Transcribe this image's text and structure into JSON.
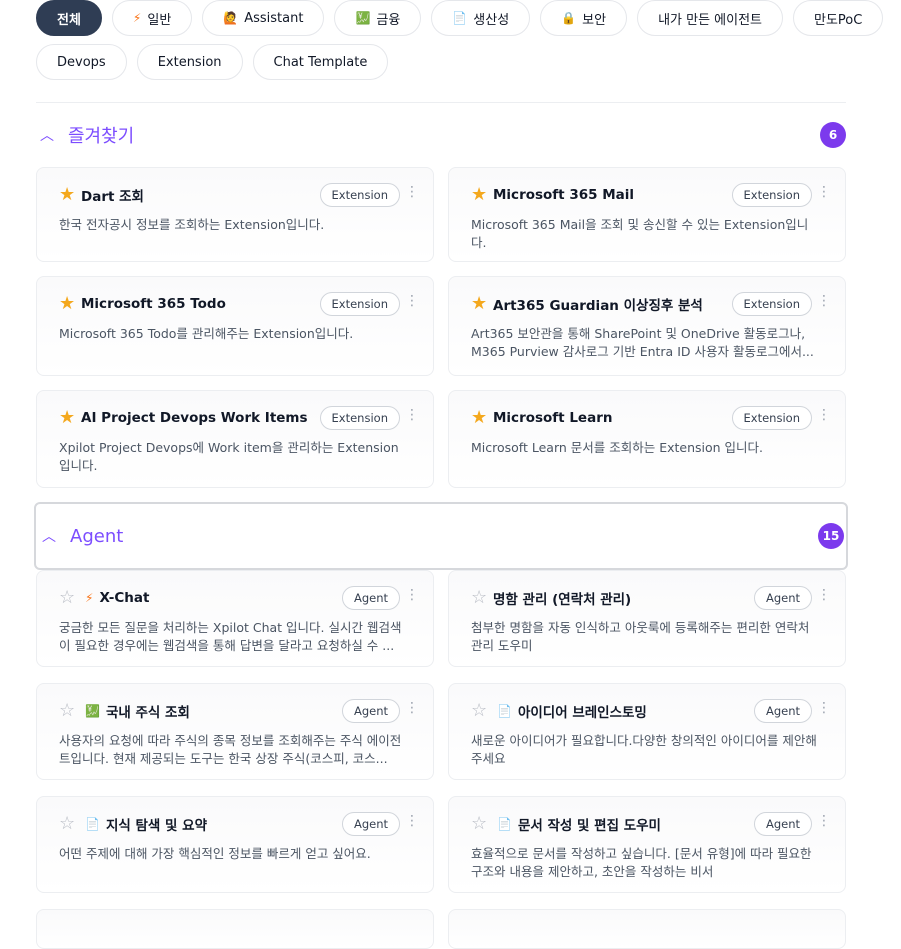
{
  "filters": {
    "row1": [
      {
        "label": "전체",
        "icon": "",
        "active": true
      },
      {
        "label": "일반",
        "icon": "⚡",
        "active": false
      },
      {
        "label": "Assistant",
        "icon": "🙋",
        "active": false
      },
      {
        "label": "금융",
        "icon": "💹",
        "active": false
      },
      {
        "label": "생산성",
        "icon": "📄",
        "active": false
      },
      {
        "label": "보안",
        "icon": "🔒",
        "active": false
      },
      {
        "label": "내가 만든 에이전트",
        "icon": "",
        "active": false
      },
      {
        "label": "만도PoC",
        "icon": "",
        "active": false
      }
    ],
    "row2": [
      {
        "label": "Devops",
        "icon": "",
        "active": false
      },
      {
        "label": "Extension",
        "icon": "",
        "active": false
      },
      {
        "label": "Chat Template",
        "icon": "",
        "active": false
      }
    ]
  },
  "favorites": {
    "title": "즐겨찾기",
    "count": "6",
    "cards": [
      {
        "name": "Dart 조회",
        "badge": "Extension",
        "desc": "한국 전자공시 정보를 조회하는 Extension입니다.",
        "icon": ""
      },
      {
        "name": "Microsoft 365 Mail",
        "badge": "Extension",
        "desc": "Microsoft 365 Mail을 조회 및 송신할 수 있는 Extension입니다.",
        "icon": ""
      },
      {
        "name": "Microsoft 365 Todo",
        "badge": "Extension",
        "desc": "Microsoft 365 Todo를 관리해주는 Extension입니다.",
        "icon": ""
      },
      {
        "name": "Art365 Guardian 이상징후 분석",
        "badge": "Extension",
        "desc": "Art365 보안관을 통해 SharePoint 및 OneDrive 활동로그나, M365 Purview 감사로그 기반 Entra ID 사용자 활동로그에서...",
        "icon": ""
      },
      {
        "name": "AI Project Devops Work Items",
        "badge": "Extension",
        "desc": "Xpilot Project Devops에 Work item을 관리하는 Extension 입니다.",
        "icon": ""
      },
      {
        "name": "Microsoft Learn",
        "badge": "Extension",
        "desc": "Microsoft Learn 문서를 조회하는 Extension 입니다.",
        "icon": ""
      }
    ]
  },
  "agent": {
    "title": "Agent",
    "count": "15",
    "cards": [
      {
        "name": "X-Chat",
        "badge": "Agent",
        "desc": "궁금한 모든 질문을 처리하는 Xpilot Chat 입니다. 실시간 웹검색이 필요한 경우에는 웹검색을 통해 답변을 달라고 요청하실 수 ...",
        "icon": "⚡"
      },
      {
        "name": "명함 관리 (연락처 관리)",
        "badge": "Agent",
        "desc": "첨부한 명함을 자동 인식하고 아웃룩에 등록해주는 편리한 연락처 관리 도우미",
        "icon": ""
      },
      {
        "name": "국내 주식 조회",
        "badge": "Agent",
        "desc": "사용자의 요청에 따라 주식의 종목 정보를 조회해주는 주식 에이전트입니다. 현재 제공되는 도구는 한국 상장 주식(코스피, 코스...",
        "icon": "💹"
      },
      {
        "name": "아이디어 브레인스토밍",
        "badge": "Agent",
        "desc": "새로운 아이디어가 필요합니다.다양한 창의적인 아이디어를 제안해 주세요",
        "icon": "📄"
      },
      {
        "name": "지식 탐색 및 요약",
        "badge": "Agent",
        "desc": "어떤 주제에 대해 가장 핵심적인 정보를 빠르게 얻고 싶어요.",
        "icon": "📄"
      },
      {
        "name": "문서 작성 및 편집 도우미",
        "badge": "Agent",
        "desc": "효율적으로 문서를 작성하고 싶습니다. [문서 유형]에 따라 필요한 구조와 내용을 제안하고, 초안을 작성하는 비서",
        "icon": "📄"
      }
    ]
  }
}
